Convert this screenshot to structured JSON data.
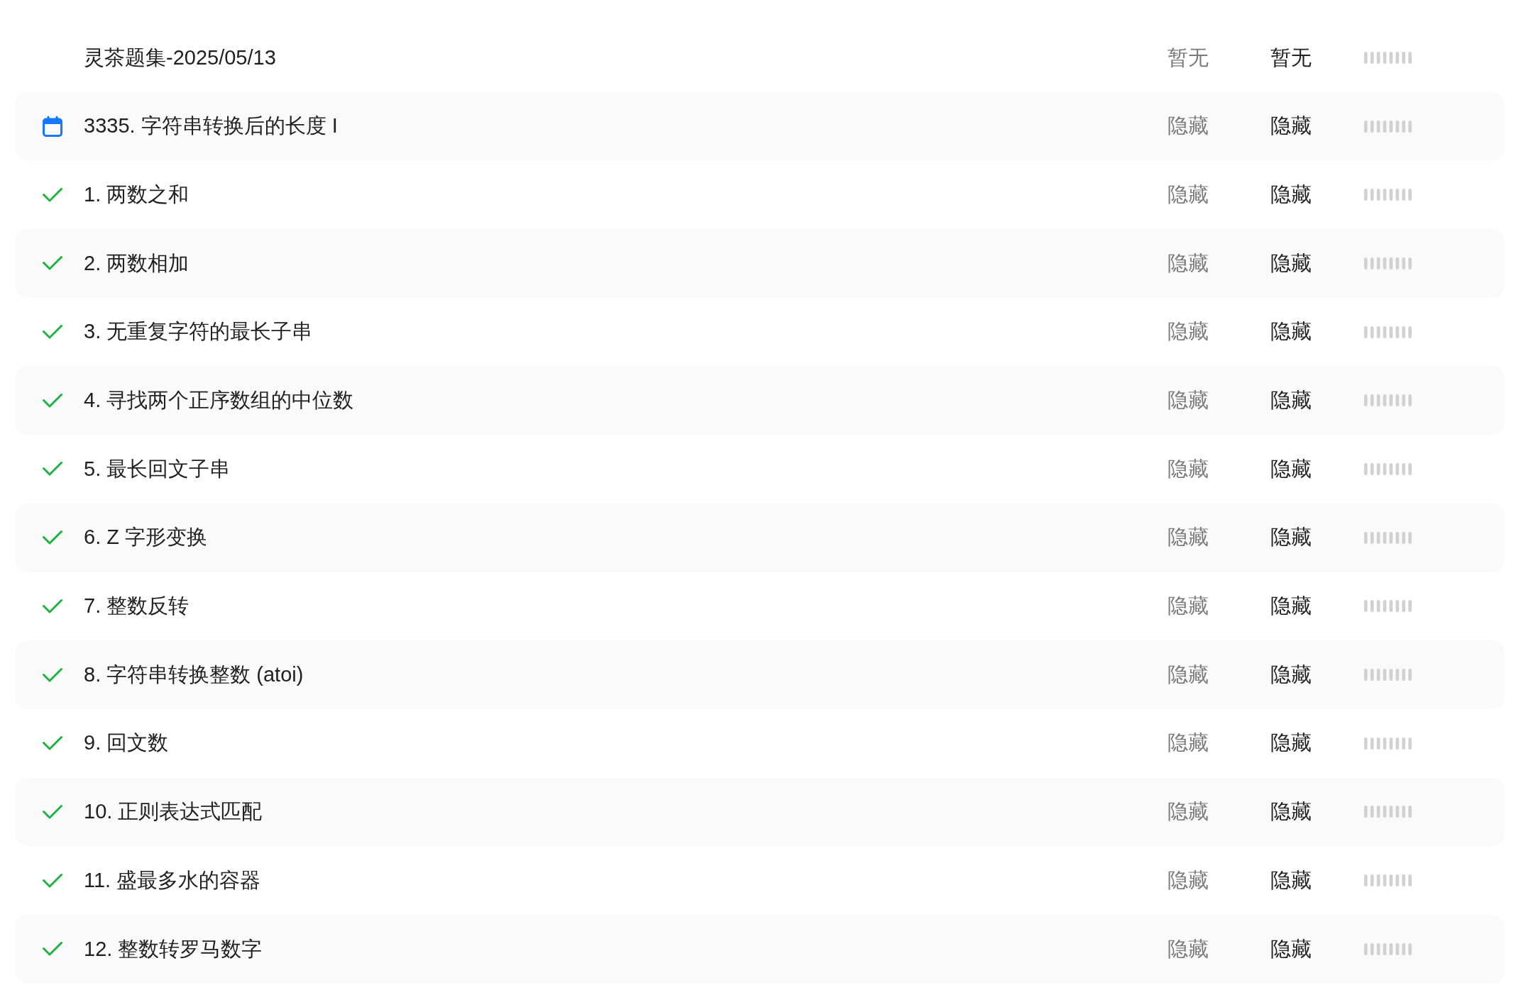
{
  "header": {
    "title": "灵茶题集-2025/05/13",
    "column_2": "暂无",
    "column_3": "暂无"
  },
  "rows": [
    {
      "kind": "daily",
      "title": "3335. 字符串转换后的长度 I",
      "column_2": "隐藏",
      "column_3": "隐藏"
    },
    {
      "kind": "problem",
      "solved": true,
      "title": "1. 两数之和",
      "column_2": "隐藏",
      "column_3": "隐藏"
    },
    {
      "kind": "problem",
      "solved": true,
      "title": "2. 两数相加",
      "column_2": "隐藏",
      "column_3": "隐藏"
    },
    {
      "kind": "problem",
      "solved": true,
      "title": "3. 无重复字符的最长子串",
      "column_2": "隐藏",
      "column_3": "隐藏"
    },
    {
      "kind": "problem",
      "solved": true,
      "title": "4. 寻找两个正序数组的中位数",
      "column_2": "隐藏",
      "column_3": "隐藏"
    },
    {
      "kind": "problem",
      "solved": true,
      "title": "5. 最长回文子串",
      "column_2": "隐藏",
      "column_3": "隐藏"
    },
    {
      "kind": "problem",
      "solved": true,
      "title": "6. Z 字形变换",
      "column_2": "隐藏",
      "column_3": "隐藏"
    },
    {
      "kind": "problem",
      "solved": true,
      "title": "7. 整数反转",
      "column_2": "隐藏",
      "column_3": "隐藏"
    },
    {
      "kind": "problem",
      "solved": true,
      "title": "8. 字符串转换整数 (atoi)",
      "column_2": "隐藏",
      "column_3": "隐藏"
    },
    {
      "kind": "problem",
      "solved": true,
      "title": "9. 回文数",
      "column_2": "隐藏",
      "column_3": "隐藏"
    },
    {
      "kind": "problem",
      "solved": true,
      "title": "10. 正则表达式匹配",
      "column_2": "隐藏",
      "column_3": "隐藏"
    },
    {
      "kind": "problem",
      "solved": true,
      "title": "11. 盛最多水的容器",
      "column_2": "隐藏",
      "column_3": "隐藏"
    },
    {
      "kind": "problem",
      "solved": true,
      "title": "12. 整数转罗马数字",
      "column_2": "隐藏",
      "column_3": "隐藏"
    }
  ]
}
